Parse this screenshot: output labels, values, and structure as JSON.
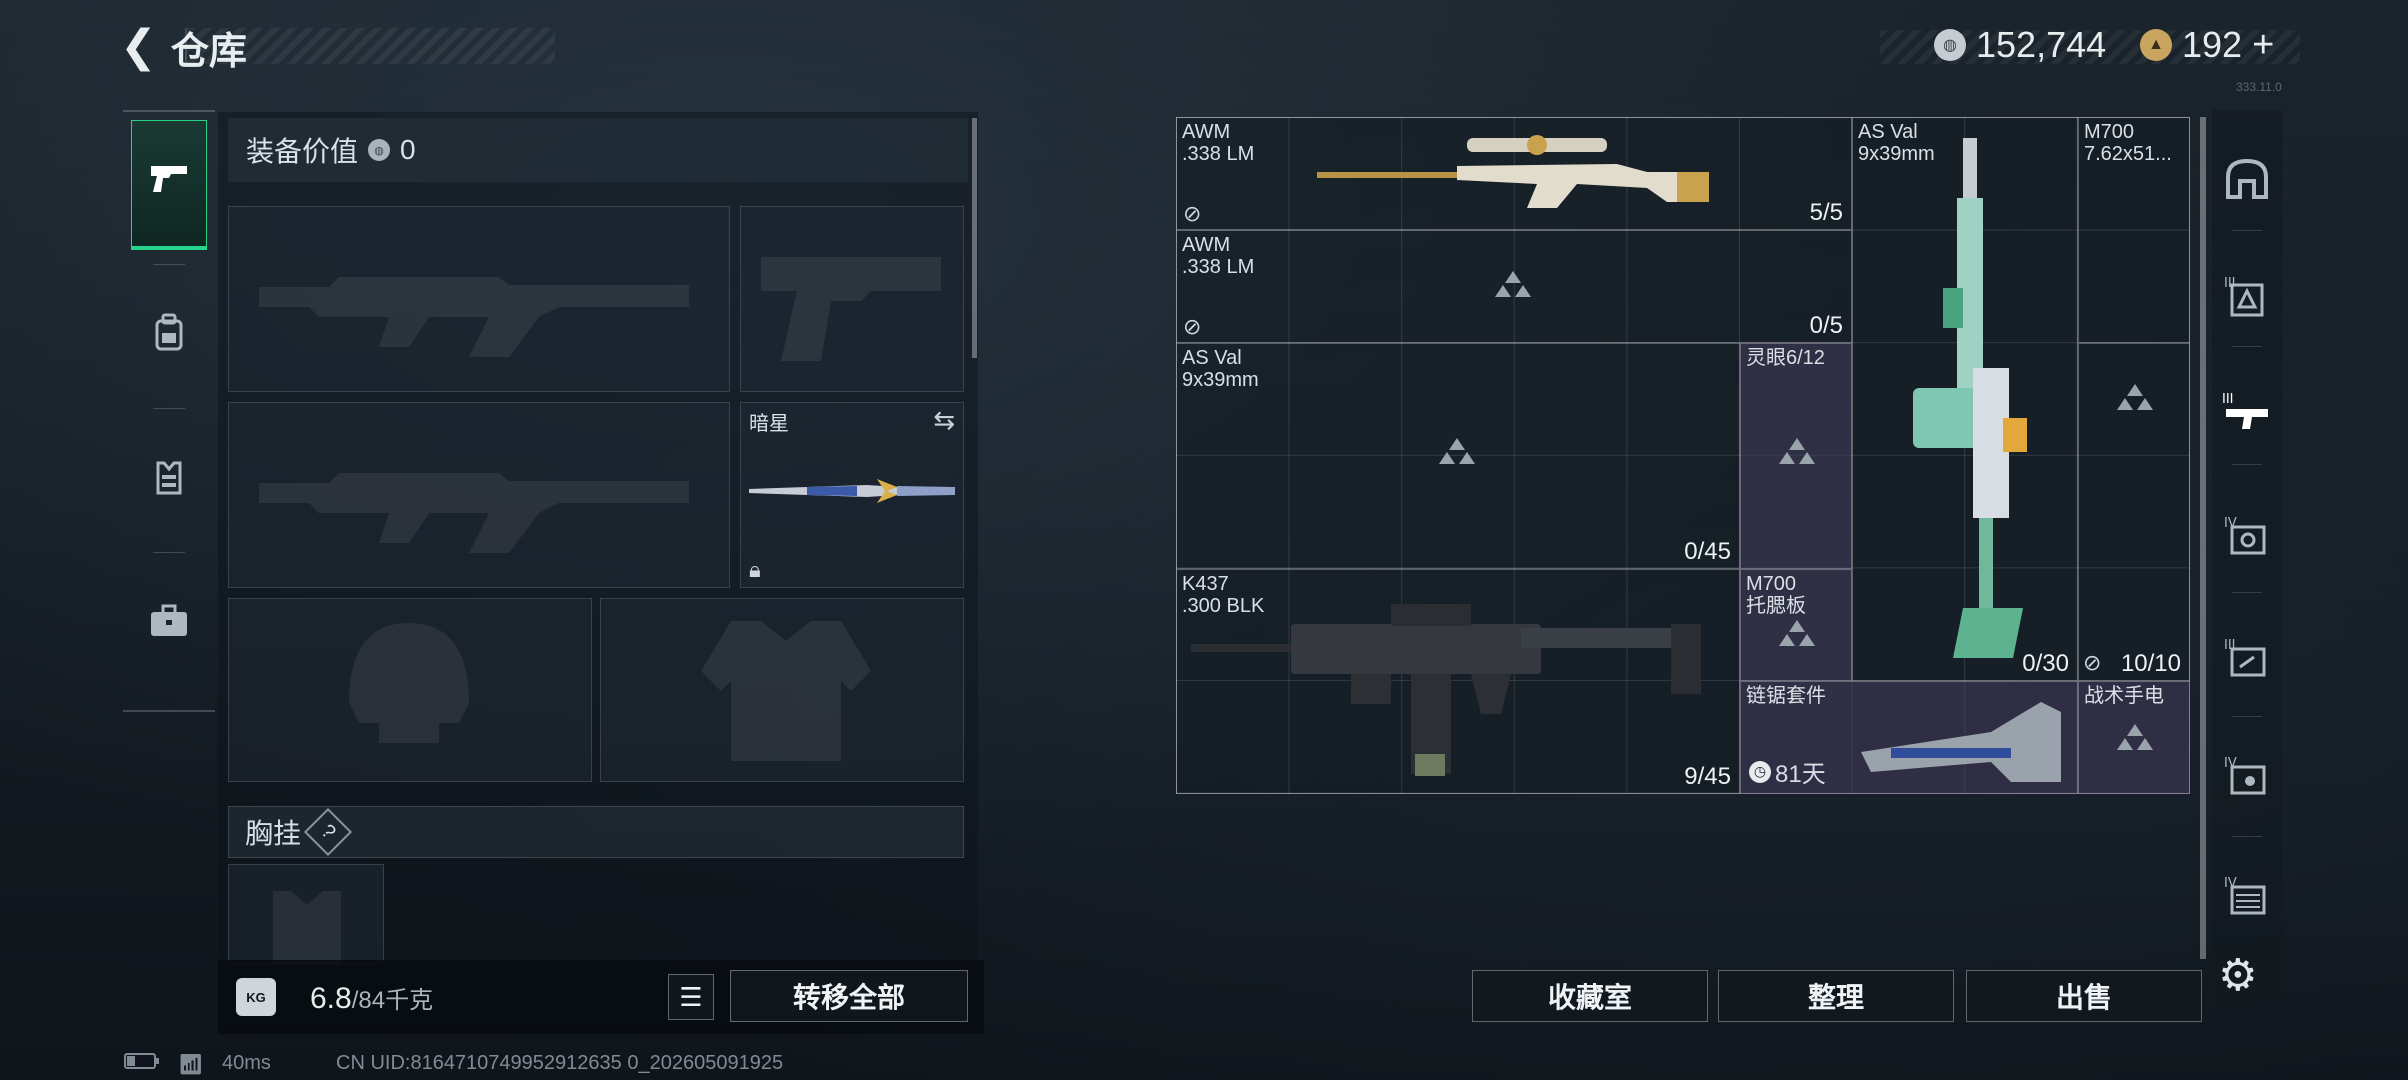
{
  "header": {
    "title": "仓库",
    "currency1": "152,744",
    "currency2": "192",
    "currency2_suffix": "+",
    "version": "333.11.0"
  },
  "left_nav": {
    "items": [
      {
        "name": "weapons",
        "icon": "pistol-icon"
      },
      {
        "name": "backpack",
        "icon": "backpack-icon"
      },
      {
        "name": "vest",
        "icon": "vest-icon"
      },
      {
        "name": "case",
        "icon": "briefcase-icon"
      }
    ]
  },
  "equipment": {
    "value_label": "装备价值",
    "value": "0",
    "knife_name": "暗星",
    "vest_label": "胸挂",
    "vest_help": "?"
  },
  "bottom": {
    "weight_icon": "KG",
    "weight_current": "6.8",
    "weight_max": "/84千克",
    "transfer_all": "转移全部",
    "collection": "收藏室",
    "organize": "整理",
    "sell": "出售"
  },
  "status": {
    "ping": "40ms",
    "uid": "CN UID:8164710749952912635 0_202605091925"
  },
  "inventory": {
    "awm1_name": "AWM",
    "awm1_cal": ".338 LM",
    "awm1_count": "5/5",
    "asval_top_name": "AS Val",
    "asval_top_cal": "9x39mm",
    "m700_name": "M700",
    "m700_cal": "7.62x51...",
    "awm2_name": "AWM",
    "awm2_cal": ".338 LM",
    "awm2_count": "0/5",
    "asval_name": "AS Val",
    "asval_cal": "9x39mm",
    "asval_count": "0/45",
    "scope_name": "灵眼6/12",
    "k437_name": "K437",
    "k437_cal": ".300 BLK",
    "k437_count": "9/45",
    "stock_name": "M700",
    "stock_sub": "托腮板",
    "rifle_ammo": "0/30",
    "m700_ammo": "10/10",
    "chainsaw_name": "链锯套件",
    "chainsaw_days": "81天",
    "flashlight_name": "战术手电"
  },
  "colors": {
    "accent_green": "#25d48a",
    "highlight_purple": "#463c5f"
  }
}
